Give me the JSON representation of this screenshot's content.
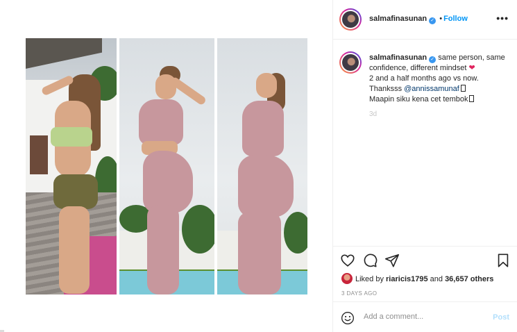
{
  "post": {
    "username": "salmafinasunan",
    "verified_icon": "verified-badge-icon",
    "separator": "•",
    "follow_label": "Follow",
    "more_label": "•••"
  },
  "caption": {
    "username": "salmafinasunan",
    "line1": "same person, same",
    "line2": "confidence, different mindset",
    "heart": "❤",
    "line3": "2 and a half months ago vs now.",
    "line4_prefix": "Thanksss ",
    "mention": "@annissamunaf",
    "line5": "Maapin siku kena cet tembok",
    "age": "3d"
  },
  "actions": {
    "icons": [
      "heart-icon",
      "comment-icon",
      "share-icon",
      "bookmark-icon"
    ],
    "liked_by_prefix": "Liked by ",
    "liked_by_user": "riaricis1795",
    "liked_by_and": " and ",
    "liked_by_count": "36,657 others",
    "timestamp": "3 DAYS AGO"
  },
  "comment_box": {
    "placeholder": "Add a comment...",
    "post_label": "Post"
  },
  "colors": {
    "link": "#0095f6",
    "post_disabled": "#b2dffc",
    "heart": "#e0245e"
  }
}
